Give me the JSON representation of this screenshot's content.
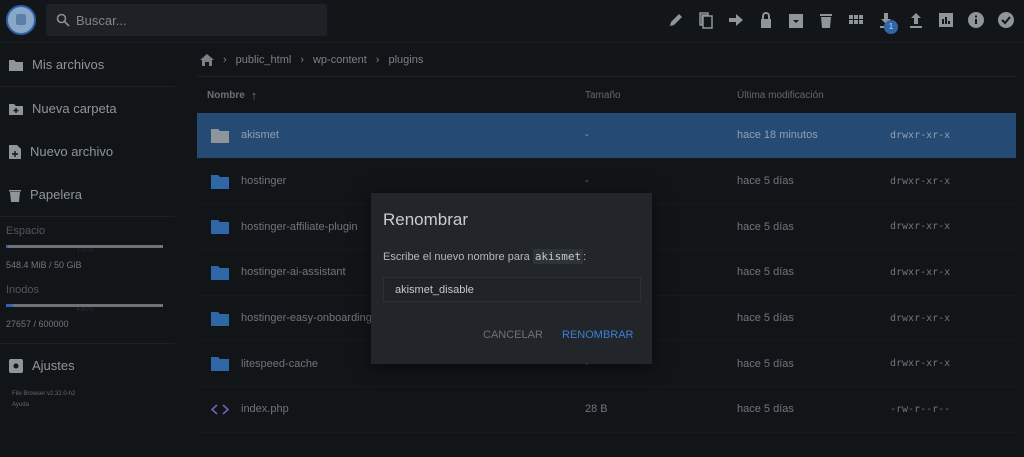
{
  "header": {
    "search_placeholder": "Buscar...",
    "badge_count": "1",
    "tools": [
      "pencil-icon",
      "copy-icon",
      "move-icon",
      "lock-icon",
      "archive-icon",
      "trash-icon",
      "grid-icon",
      "download-icon",
      "upload-icon",
      "chart-icon",
      "info-icon",
      "check-circle-icon"
    ]
  },
  "sidebar": {
    "items": [
      {
        "label": "Mis archivos"
      },
      {
        "label": "Nueva carpeta"
      },
      {
        "label": "Nuevo archivo"
      },
      {
        "label": "Papelera"
      }
    ],
    "space_label": "Espacio",
    "space_pct": "1.07%",
    "space_value": "548.4 MiB / 50 GiB",
    "space_fraction": 0.0107,
    "inodes_label": "Inodos",
    "inodes_pct": "4.61%",
    "inodes_value": "27657 / 600000",
    "inodes_fraction": 0.0461,
    "settings": "Ajustes",
    "version": "File Browser v2.32.0-h2",
    "help": "Ayuda"
  },
  "breadcrumb": [
    "public_html",
    "wp-content",
    "plugins"
  ],
  "table": {
    "headers": {
      "name": "Nombre",
      "size": "Tamaño",
      "modified": "Última modificación"
    },
    "rows": [
      {
        "name": "akismet",
        "size": "-",
        "modified": "hace 18 minutos",
        "perms": "drwxr-xr-x",
        "type": "folder"
      },
      {
        "name": "hostinger",
        "size": "-",
        "modified": "hace 5 días",
        "perms": "drwxr-xr-x",
        "type": "folder"
      },
      {
        "name": "hostinger-affiliate-plugin",
        "size": "-",
        "modified": "hace 5 días",
        "perms": "drwxr-xr-x",
        "type": "folder"
      },
      {
        "name": "hostinger-ai-assistant",
        "size": "-",
        "modified": "hace 5 días",
        "perms": "drwxr-xr-x",
        "type": "folder"
      },
      {
        "name": "hostinger-easy-onboarding",
        "size": "-",
        "modified": "hace 5 días",
        "perms": "drwxr-xr-x",
        "type": "folder"
      },
      {
        "name": "litespeed-cache",
        "size": "-",
        "modified": "hace 5 días",
        "perms": "drwxr-xr-x",
        "type": "folder"
      },
      {
        "name": "index.php",
        "size": "28 B",
        "modified": "hace 5 días",
        "perms": "-rw-r--r--",
        "type": "code"
      }
    ]
  },
  "dialog": {
    "title": "Renombrar",
    "prompt": "Escribe el nuevo nombre para ",
    "target": "akismet",
    "colon": ":",
    "value": "akismet_disable",
    "cancel": "CANCELAR",
    "confirm": "RENOMBRAR"
  },
  "colors": {
    "accent": "#2f66a8",
    "selected_row": "#254a73",
    "confirm": "#3d7fd1"
  }
}
